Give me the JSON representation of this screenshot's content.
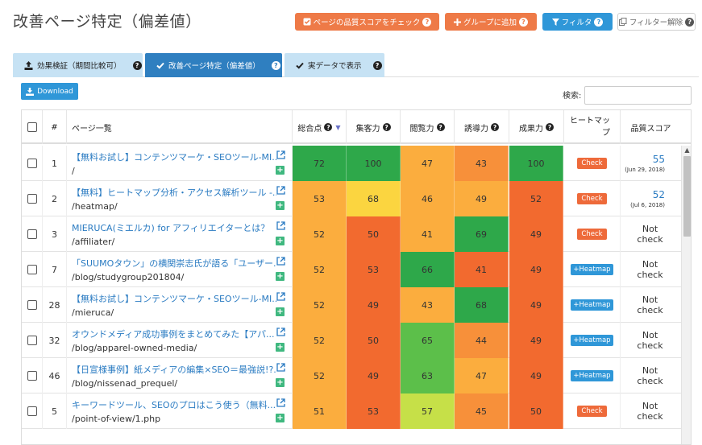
{
  "header": {
    "title": "改善ページ特定（偏差値）",
    "buttons": {
      "quality_check": "ページの品質スコアをチェック",
      "add_group": "グループに追加",
      "filter": "フィルタ",
      "clear_filter": "フィルター解除"
    }
  },
  "tabs": [
    {
      "label": "効果検証（期間比較可）"
    },
    {
      "label": "改善ページ特定（偏差値）"
    },
    {
      "label": "実データで表示"
    }
  ],
  "toolbar": {
    "download_label": "Download",
    "search_label": "検索:",
    "search_value": ""
  },
  "table": {
    "columns": {
      "num": "#",
      "page": "ページ一覧",
      "total": "総合点",
      "traffic": "集客力",
      "browse": "閲覧力",
      "guide": "誘導力",
      "result": "成果力",
      "heatmap_l1": "ヒートマッ",
      "heatmap_l2": "プ",
      "quality": "品質スコア"
    },
    "rows": [
      {
        "num": "1",
        "title": "【無料お試し】コンテンツマーケ・SEOツール-MI...",
        "path": "/",
        "total": "72",
        "traffic": "100",
        "browse": "47",
        "guide": "43",
        "result": "100",
        "heatmap": "Check",
        "quality": "55",
        "quality_date": "(Jun 29, 2018)"
      },
      {
        "num": "2",
        "title": "【無料】ヒートマップ分析・アクセス解析ツール -...",
        "path": "/heatmap/",
        "total": "53",
        "traffic": "68",
        "browse": "46",
        "guide": "49",
        "result": "52",
        "heatmap": "Check",
        "quality": "52",
        "quality_date": "(Jul 6, 2018)"
      },
      {
        "num": "3",
        "title": "MIERUCA(ミエルカ) for アフィリエイターとは？",
        "path": "/affiliater/",
        "total": "52",
        "traffic": "50",
        "browse": "41",
        "guide": "69",
        "result": "49",
        "heatmap": "Check",
        "quality": "Not check",
        "quality_date": ""
      },
      {
        "num": "7",
        "title": "「SUUMOタウン」の横関崇志氏が語る「ユーザー...",
        "path": "/blog/studygroup201804/",
        "total": "52",
        "traffic": "53",
        "browse": "66",
        "guide": "41",
        "result": "49",
        "heatmap": "+Heatmap",
        "quality": "Not check",
        "quality_date": ""
      },
      {
        "num": "28",
        "title": "【無料お試し】コンテンツマーケ・SEOツール-MI...",
        "path": "/mieruca/",
        "total": "52",
        "traffic": "49",
        "browse": "43",
        "guide": "68",
        "result": "49",
        "heatmap": "+Heatmap",
        "quality": "Not check",
        "quality_date": ""
      },
      {
        "num": "32",
        "title": "オウンドメディア成功事例をまとめてみた【アパ...",
        "path": "/blog/apparel-owned-media/",
        "total": "52",
        "traffic": "50",
        "browse": "65",
        "guide": "44",
        "result": "49",
        "heatmap": "+Heatmap",
        "quality": "Not check",
        "quality_date": ""
      },
      {
        "num": "46",
        "title": "【日宣様事例】紙メディアの編集×SEO＝最強説!?...",
        "path": "/blog/nissenad_prequel/",
        "total": "52",
        "traffic": "49",
        "browse": "63",
        "guide": "47",
        "result": "49",
        "heatmap": "+Heatmap",
        "quality": "Not check",
        "quality_date": ""
      },
      {
        "num": "5",
        "title": "キーワードツール、SEOのプロはこう使う（無料...",
        "path": "/point-of-view/1.php",
        "total": "51",
        "traffic": "53",
        "browse": "57",
        "guide": "45",
        "result": "50",
        "heatmap": "Check",
        "quality": "Not check",
        "quality_date": ""
      }
    ]
  },
  "colors": {
    "dark_green": "#2ea84a",
    "green": "#5cbf4a",
    "light_green": "#c6e048",
    "yellow": "#fbd540",
    "light_orange": "#fbad3e",
    "orange": "#f7903a",
    "red_orange": "#f26a2f",
    "accent_blue": "#2f97d8",
    "accent_orange": "#ee7a47"
  }
}
